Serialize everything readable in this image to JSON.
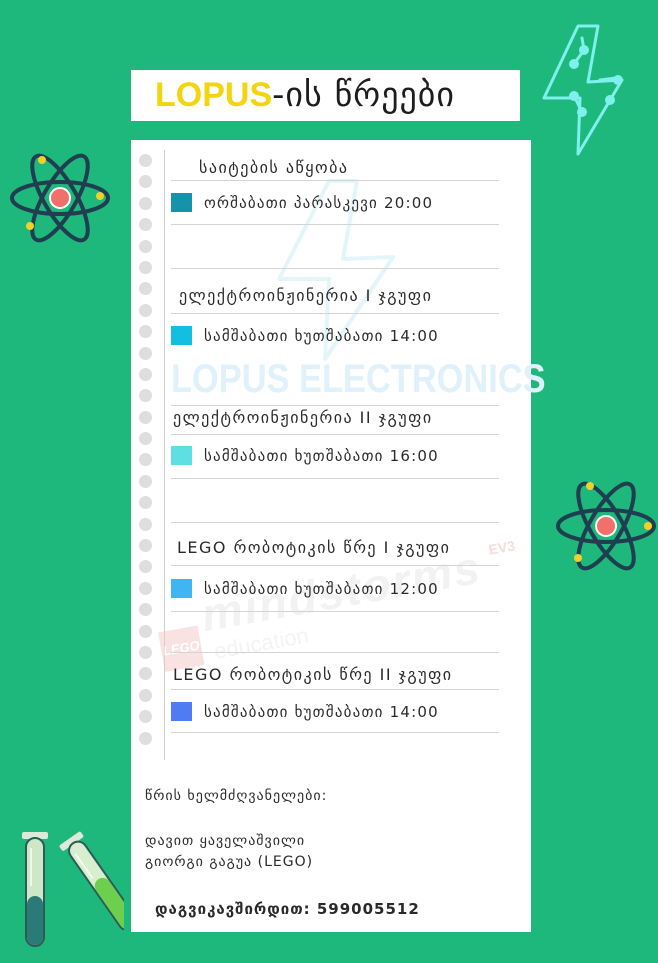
{
  "title": {
    "brand": "LOPUS",
    "suffix": "-ის წრეები"
  },
  "watermark": {
    "text": "LOPUS ELECTRONICS",
    "lego_line1": "mindstorms",
    "lego_line2": "education",
    "lego_tag": "EV3",
    "lego_logo": "LEGO"
  },
  "sections": [
    {
      "heading": "საიტების აწყობა",
      "schedule": "ორშაბათი პარასკევი 20:00",
      "color": "#1593ad"
    },
    {
      "heading": "ელექტროინჟინერია I ჯგუფი",
      "schedule": "სამშაბათი ხუთშაბათი 14:00",
      "color": "#12bfe0"
    },
    {
      "heading": "ელექტროინჟინერია II ჯგუფი",
      "schedule": "სამშაბათი ხუთშაბათი 16:00",
      "color": "#5ee0e3"
    },
    {
      "heading": "LEGO რობოტიკის წრე I ჯგუფი",
      "schedule": "სამშაბათი ხუთშაბათი 12:00",
      "color": "#3fb6f3"
    },
    {
      "heading": "LEGO რობოტიკის წრე II ჯგუფი",
      "schedule": "სამშაბათი ხუთშაბათი 14:00",
      "color": "#4f7cf2"
    }
  ],
  "leaders": {
    "label": "წრის ხელმძღვანელები:",
    "names": [
      "დავით ყაველაშვილი",
      "გიორგი გაგუა (LEGO)"
    ]
  },
  "contact": "დაგვიკავშირდით: 599005512",
  "icons": [
    "lightning-bolt-icon",
    "atom-icon",
    "test-tube-icon"
  ],
  "colors": {
    "background": "#1fb87c",
    "brand": "#f3d40e",
    "paper": "#ffffff"
  }
}
